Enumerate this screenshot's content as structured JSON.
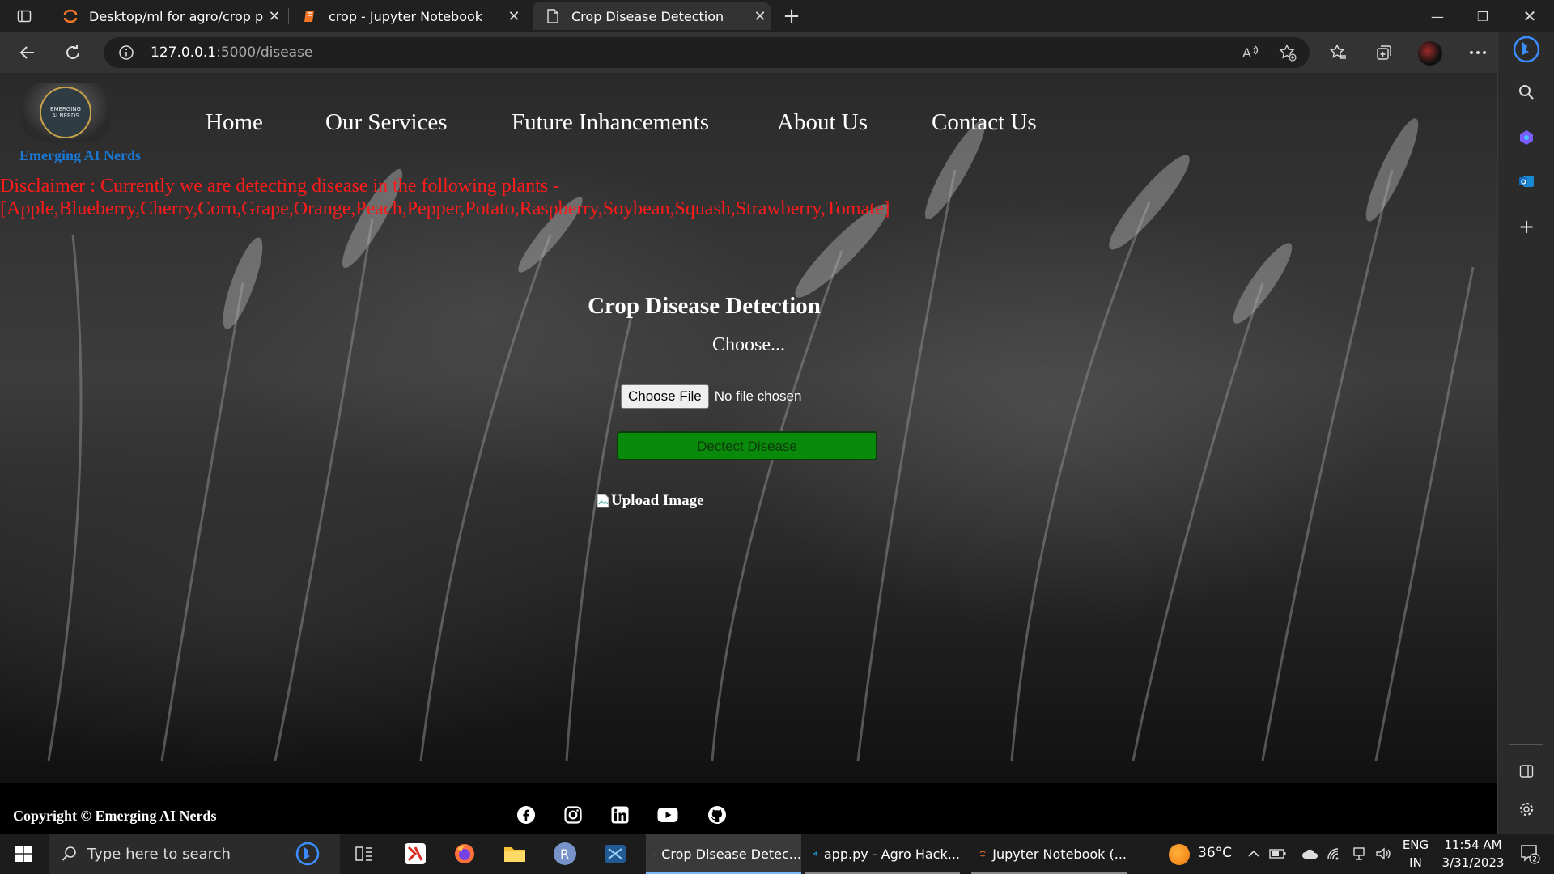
{
  "browser": {
    "tabs": [
      {
        "title": "Desktop/ml for agro/crop predic",
        "close": "✕",
        "active": false
      },
      {
        "title": "crop - Jupyter Notebook",
        "close": "✕",
        "active": false
      },
      {
        "title": "Crop Disease Detection",
        "close": "✕",
        "active": true
      }
    ],
    "new_tab": "+",
    "window": {
      "minimize": "—",
      "restore": "❐",
      "close": "✕"
    },
    "url_host": "127.0.0.1",
    "url_path": ":5000/disease"
  },
  "site": {
    "brand": "Emerging AI Nerds",
    "logo_text_1": "EMERGING",
    "logo_text_2": "AI NERDS",
    "nav": [
      "Home",
      "Our Services",
      "Future Inhancements",
      "About Us",
      "Contact Us"
    ],
    "disclaimer_line1": "Disclaimer : Currently we are detecting disease in the following plants -",
    "disclaimer_line2": "[Apple,Blueberry,Cherry,Corn,Grape,Orange,Peach,Pepper,Potato,Raspberry,Soybean,Squash,Strawberry,Tomate]",
    "title": "Crop Disease Detection",
    "choose_label": "Choose...",
    "file_button": "Choose File",
    "file_status": "No file chosen",
    "detect_button": "Dectect Disease",
    "image_alt": "Upload Image",
    "copyright": "Copyright © Emerging AI Nerds",
    "social_icons": [
      "facebook-icon",
      "instagram-icon",
      "linkedin-icon",
      "youtube-icon",
      "github-icon"
    ]
  },
  "taskbar": {
    "search_placeholder": "Type here to search",
    "apps": [
      {
        "label": "Crop Disease Detec...",
        "active": true
      },
      {
        "label": "app.py - Agro Hack...",
        "active": false
      },
      {
        "label": "Jupyter Notebook (...",
        "active": false
      }
    ],
    "pinned_r_label": "R",
    "weather": "36°C",
    "lang_1": "ENG",
    "lang_2": "IN",
    "time": "11:54 AM",
    "date": "3/31/2023",
    "notifications": "2"
  },
  "colors": {
    "disclaimer": "#ff1b1b",
    "brand": "#1a78d4",
    "detect_button": "#0a8a0a"
  }
}
